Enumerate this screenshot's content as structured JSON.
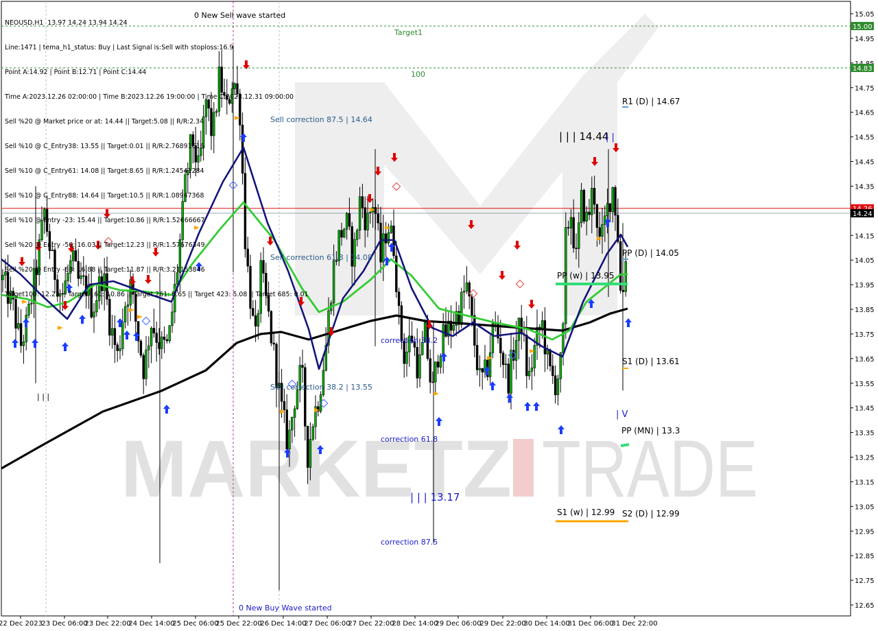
{
  "header": {
    "symbol_line": "NEOUSD,H1  13.97 14.24 13.94 14.24",
    "lines": [
      "Line:1471 | tema_h1_status: Buy | Last Signal is:Sell with stoploss:16.9",
      "Point A:14.92 | Point B:12.71 | Point C:14.44",
      "Time A:2023.12.26 02:00:00 | Time B:2023.12.26 19:00:00 | Time C:2023.12.31 09:00:00",
      "Sell %20 @ Market price or at: 14.44 || Target:5.08 || R/R:2.34",
      "Sell %10 @ C_Entry38: 13.55 || Target:0.01 || R/R:2.76891616",
      "Sell %10 @ C_Entry61: 14.08 || Target:8.65 || R/R:1.24541284",
      "Sell %10 @ C_Entry88: 14.64 || Target:10.5 || R/R:1.08947368",
      "Sell %10 @ Entry -23: 15.44 || Target:10.86 || R/R:1.52666667",
      "Sell %20 @ Entry -50: 16.03 || Target:12.23 || R/R:1.57676349",
      "Sell %20 @ Entry -88: 16.88 || Target:11.87 || R/R:3.21153846",
      "Target100: 12.23 || Target 161: 10.86 || Target 261: 8.65 || Target 423: 5.08 || Target 685: 0.01"
    ]
  },
  "watermark": {
    "left": "MARKETZ",
    "right": "TRADE"
  },
  "chart_data": {
    "type": "candlestick",
    "symbol": "NEOUSD",
    "timeframe": "H1",
    "ohlc_last": {
      "open": 13.97,
      "high": 14.24,
      "low": 13.94,
      "close": 14.24
    },
    "ylim": [
      12.62,
      15.08
    ],
    "y_ticks": [
      "15.05",
      "14.95",
      "14.85",
      "14.75",
      "14.65",
      "14.55",
      "14.45",
      "14.35",
      "14.25",
      "14.15",
      "14.05",
      "13.95",
      "13.85",
      "13.75",
      "13.65",
      "13.55",
      "13.45",
      "13.35",
      "13.25",
      "13.15",
      "13.05",
      "12.95",
      "12.85",
      "12.75",
      "12.65"
    ],
    "x_ticks": [
      "22 Dec 2023",
      "23 Dec 06:00",
      "23 Dec 22:00",
      "24 Dec 14:00",
      "25 Dec 06:00",
      "25 Dec 22:00",
      "26 Dec 14:00",
      "27 Dec 06:00",
      "27 Dec 22:00",
      "28 Dec 14:00",
      "29 Dec 06:00",
      "29 Dec 22:00",
      "30 Dec 14:00",
      "31 Dec 06:00",
      "31 Dec 22:00"
    ],
    "price_badges": [
      {
        "label": "15.00",
        "value": 15.0,
        "color": "#2e8b2e"
      },
      {
        "label": "14.83",
        "value": 14.83,
        "color": "#2e8b2e"
      },
      {
        "label": "14.26",
        "value": 14.26,
        "color": "#e01010"
      },
      {
        "label": "14.24",
        "value": 14.24,
        "color": "#000000"
      }
    ],
    "horizontal_lines": [
      {
        "value": 15.0,
        "color": "#2e8b2e",
        "style": "dashed"
      },
      {
        "value": 14.83,
        "color": "#2e8b2e",
        "style": "dashed"
      },
      {
        "value": 14.26,
        "color": "#e01010",
        "style": "solid"
      },
      {
        "value": 14.24,
        "color": "#9aa4b0",
        "style": "solid"
      }
    ],
    "levels": [
      {
        "label": "R1 (D) | 14.67",
        "value": 14.67,
        "color": "#5b9bd5",
        "text_color": "#000000"
      },
      {
        "label": "PP (D) | 14.05",
        "value": 14.05,
        "color": "#5b9bd5",
        "text_color": "#000000"
      },
      {
        "label": "PP (w) | 13.95",
        "value": 13.95,
        "color": "#33dd77",
        "text_color": "#000000"
      },
      {
        "label": "S1 (D) | 13.61",
        "value": 13.61,
        "color": "#ffa500",
        "text_color": "#000000"
      },
      {
        "label": "PP (MN) | 13.3",
        "value": 13.3,
        "color": "#33dd77",
        "text_color": "#000000"
      },
      {
        "label": "S1 (w) | 12.99",
        "value": 12.99,
        "color": "#ffa500",
        "text_color": "#000000"
      },
      {
        "label": "S2 (D) | 12.99",
        "value": 12.99,
        "color": "#ffa500",
        "text_color": "#000000"
      }
    ],
    "annotations": [
      {
        "text": "Target1",
        "color": "#2e8b2e"
      },
      {
        "text": "100",
        "color": "#2e8b2e"
      },
      {
        "text": "0 New Sell wave started",
        "color": "#000000"
      },
      {
        "text": "0 New Buy Wave started",
        "color": "#1a1acc"
      },
      {
        "text": "Sell correction 87.5 | 14.64",
        "color": "#2a5a8a"
      },
      {
        "text": "Sell correction 61.8 | 14.08",
        "color": "#2a5a8a"
      },
      {
        "text": "Sell correction 38.2 | 13.55",
        "color": "#2a5a8a"
      },
      {
        "text": "correction 38.2",
        "color": "#1a1acc"
      },
      {
        "text": "correction 61.8",
        "color": "#1a1acc"
      },
      {
        "text": "correction 87.5",
        "color": "#1a1acc"
      },
      {
        "text": "| | | 13.17",
        "color": "#1a1acc"
      },
      {
        "text": "| | | 14.44",
        "color": "#000000"
      },
      {
        "text": "| |",
        "color": "#1a1acc"
      },
      {
        "text": "| | |",
        "color": "#000000"
      },
      {
        "text": "| V",
        "color": "#1a1acc"
      }
    ],
    "series": [
      {
        "name": "",
        "color": "#000000",
        "values_approx": [
          13.21,
          13.32,
          13.44,
          13.56,
          13.72,
          13.78,
          13.77,
          13.82,
          13.8,
          13.79,
          13.8,
          13.85
        ]
      },
      {
        "name": "",
        "color": "#33cc33",
        "values_approx": [
          13.93,
          13.98,
          13.95,
          14.28,
          14.02,
          13.86,
          14.0,
          13.75,
          13.8,
          13.78,
          13.95,
          14.0
        ]
      },
      {
        "name": "",
        "color": "#14147a",
        "values_approx": [
          14.05,
          13.85,
          14.0,
          14.52,
          13.97,
          13.6,
          14.13,
          13.78,
          13.8,
          13.72,
          14.15,
          13.85
        ]
      }
    ],
    "candles_summary": {
      "count": 240,
      "high": 14.92,
      "low": 12.71
    }
  }
}
